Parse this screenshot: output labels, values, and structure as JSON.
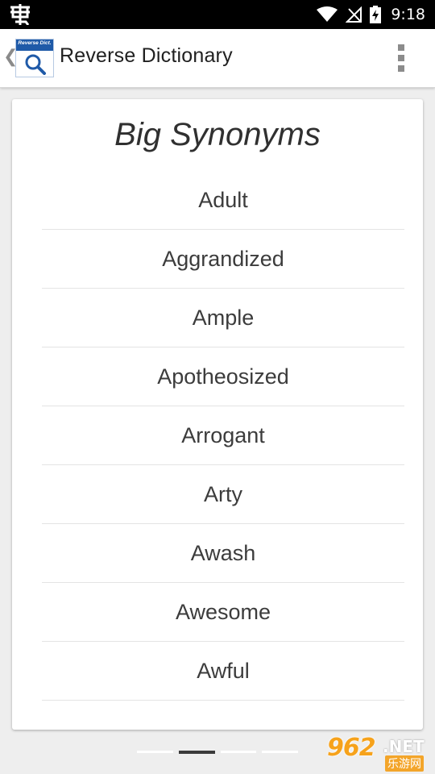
{
  "status_bar": {
    "time": "9:18",
    "icons": [
      "debug-icon",
      "wifi-icon",
      "no-signal-icon",
      "battery-charging-icon"
    ]
  },
  "app_bar": {
    "logo_text": "Reverse Dict.",
    "title": "Reverse Dictionary",
    "up_glyph": "❮",
    "overflow_icon": "overflow-menu-icon"
  },
  "card": {
    "title": "Big Synonyms",
    "words": [
      "Adult",
      "Aggrandized",
      "Ample",
      "Apotheosized",
      "Arrogant",
      "Arty",
      "Awash",
      "Awesome",
      "Awful"
    ]
  },
  "pager": {
    "pages": 4,
    "active_index": 1
  },
  "watermark": {
    "number": "962",
    "suffix": ".NET",
    "chinese": "乐游网"
  },
  "colors": {
    "status_bar": "#000000",
    "app_bar": "#ffffff",
    "background": "#eeeeee",
    "logo_band": "#1f5aa8",
    "watermark_orange": "#f6a21b"
  }
}
